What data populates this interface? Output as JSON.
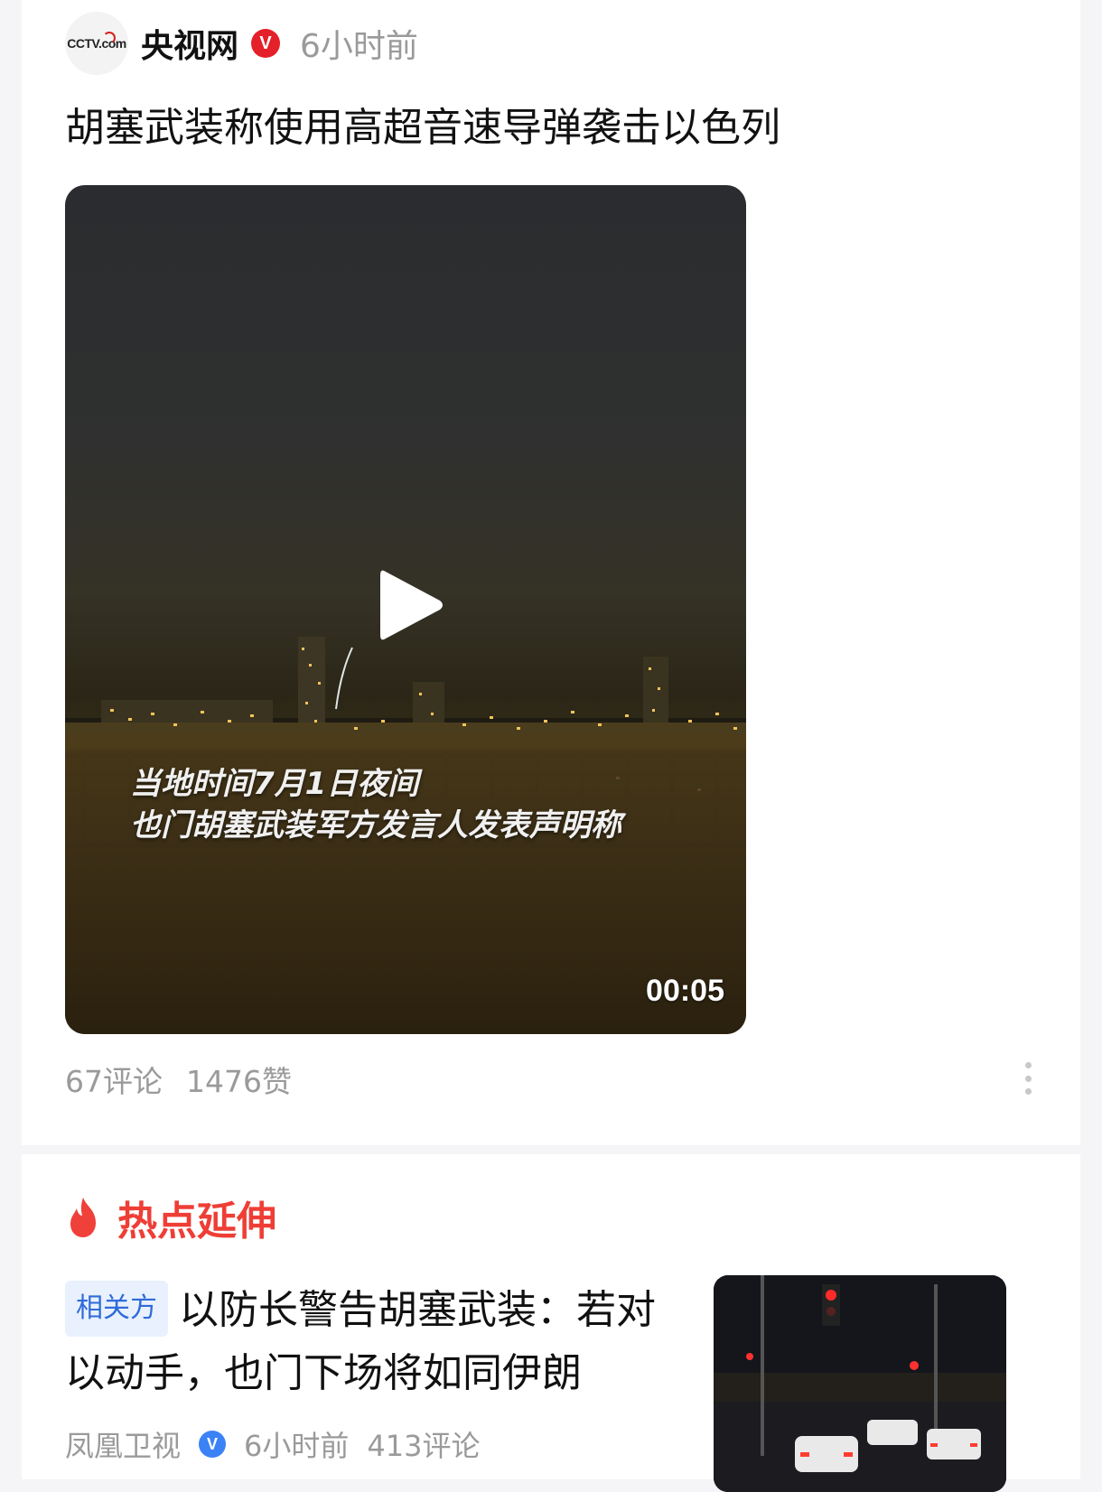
{
  "post": {
    "source": {
      "logo": "CCTV.com",
      "name": "央视网",
      "verified_mark": "V",
      "time": "6小时前"
    },
    "title": "胡塞武装称使用高超音速导弹袭击以色列",
    "video": {
      "subtitle_line1": "当地时间7月1日夜间",
      "subtitle_line2": "也门胡塞武装军方发言人发表声明称",
      "duration": "00:05"
    },
    "stats": {
      "comments": "67评论",
      "likes": "1476赞"
    }
  },
  "hot": {
    "title": "热点延伸",
    "items": [
      {
        "tag": "相关方",
        "title": "以防长警告胡塞武装：若对以动手，也门下场将如同伊朗",
        "source": "凤凰卫视",
        "verified_mark": "V",
        "time": "6小时前",
        "comments": "413评论"
      }
    ]
  },
  "colors": {
    "accent_red": "#ee3e36",
    "verify_red": "#e4202a",
    "tag_blue": "#2f6bd8",
    "meta_gray": "#9a9a9a"
  }
}
